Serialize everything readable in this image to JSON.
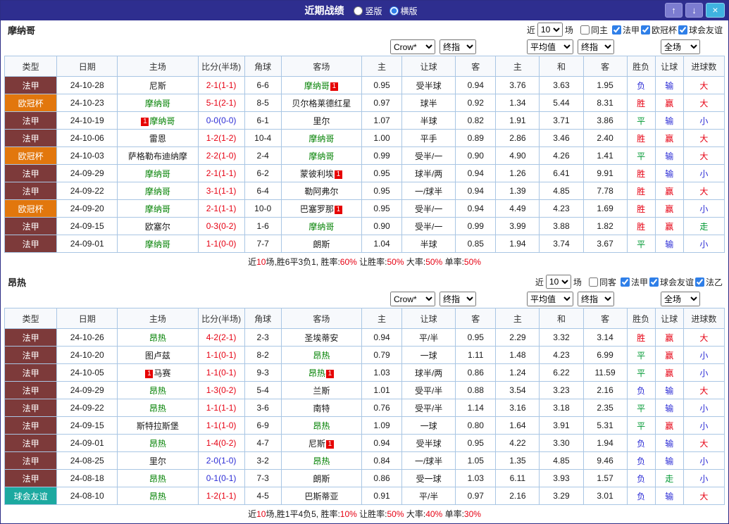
{
  "palette": {
    "red": "#e60012",
    "blue": "#2b2bd5",
    "green": "#009933",
    "black": "#1a1a1a",
    "team_green": "#008000",
    "type_ligue1": "#7d3a3a",
    "type_ucl": "#e2770d",
    "type_friendly": "#1ca9a0",
    "card_red": "#e60000",
    "titlebar_bg": "#2e2e8f",
    "border_blue": "#a9c6e4"
  },
  "titlebar": {
    "title": "近期战绩",
    "radios": [
      {
        "label": "竖版",
        "checked": false
      },
      {
        "label": "横版",
        "checked": true
      }
    ],
    "up_icon": "↑",
    "down_icon": "↓",
    "close_icon": "×"
  },
  "table": {
    "columns": [
      "类型",
      "日期",
      "主场",
      "比分(半场)",
      "角球",
      "客场",
      "主",
      "让球",
      "客",
      "主",
      "和",
      "客",
      "胜负",
      "让球",
      "进球数"
    ],
    "dropdowns": {
      "bookmaker": "Crow*",
      "final_a": "终指",
      "average": "平均值",
      "final_e": "终指",
      "scope": "全场"
    }
  },
  "sections": [
    {
      "team": "摩纳哥",
      "filter": {
        "near": "近",
        "count": "10",
        "games": "场",
        "same": "同主",
        "leagues": [
          "法甲",
          "欧冠杯",
          "球会友谊"
        ]
      },
      "rows": [
        {
          "type": "法甲",
          "tc": "ligue1",
          "date": "24-10-28",
          "home": {
            "n": "尼斯",
            "c": "black"
          },
          "score": {
            "t": "2-1(1-1)",
            "c": "red"
          },
          "corner": "6-6",
          "away": {
            "n": "摩纳哥",
            "c": "green",
            "card": "1",
            "cardpos": "after"
          },
          "odds": [
            "0.95",
            "受半球",
            "0.94",
            "3.76",
            "3.63",
            "1.95"
          ],
          "res": [
            [
              "负",
              "blue"
            ],
            [
              "输",
              "blue"
            ],
            [
              "大",
              "red"
            ]
          ]
        },
        {
          "type": "欧冠杯",
          "tc": "ucl",
          "date": "24-10-23",
          "home": {
            "n": "摩纳哥",
            "c": "green"
          },
          "score": {
            "t": "5-1(2-1)",
            "c": "red"
          },
          "corner": "8-5",
          "away": {
            "n": "贝尔格莱德红星",
            "c": "black"
          },
          "odds": [
            "0.97",
            "球半",
            "0.92",
            "1.34",
            "5.44",
            "8.31"
          ],
          "res": [
            [
              "胜",
              "red"
            ],
            [
              "赢",
              "red"
            ],
            [
              "大",
              "red"
            ]
          ]
        },
        {
          "type": "法甲",
          "tc": "ligue1",
          "date": "24-10-19",
          "home": {
            "n": "摩纳哥",
            "c": "green",
            "card": "1",
            "cardpos": "before"
          },
          "score": {
            "t": "0-0(0-0)",
            "c": "blue"
          },
          "corner": "6-1",
          "away": {
            "n": "里尔",
            "c": "black"
          },
          "odds": [
            "1.07",
            "半球",
            "0.82",
            "1.91",
            "3.71",
            "3.86"
          ],
          "res": [
            [
              "平",
              "green"
            ],
            [
              "输",
              "blue"
            ],
            [
              "小",
              "blue"
            ]
          ]
        },
        {
          "type": "法甲",
          "tc": "ligue1",
          "date": "24-10-06",
          "home": {
            "n": "雷恩",
            "c": "black"
          },
          "score": {
            "t": "1-2(1-2)",
            "c": "red"
          },
          "corner": "10-4",
          "away": {
            "n": "摩纳哥",
            "c": "green"
          },
          "odds": [
            "1.00",
            "平手",
            "0.89",
            "2.86",
            "3.46",
            "2.40"
          ],
          "res": [
            [
              "胜",
              "red"
            ],
            [
              "赢",
              "red"
            ],
            [
              "大",
              "red"
            ]
          ]
        },
        {
          "type": "欧冠杯",
          "tc": "ucl",
          "date": "24-10-03",
          "home": {
            "n": "萨格勒布迪纳摩",
            "c": "black"
          },
          "score": {
            "t": "2-2(1-0)",
            "c": "red"
          },
          "corner": "2-4",
          "away": {
            "n": "摩纳哥",
            "c": "green"
          },
          "odds": [
            "0.99",
            "受半/一",
            "0.90",
            "4.90",
            "4.26",
            "1.41"
          ],
          "res": [
            [
              "平",
              "green"
            ],
            [
              "输",
              "blue"
            ],
            [
              "大",
              "red"
            ]
          ]
        },
        {
          "type": "法甲",
          "tc": "ligue1",
          "date": "24-09-29",
          "home": {
            "n": "摩纳哥",
            "c": "green"
          },
          "score": {
            "t": "2-1(1-1)",
            "c": "red"
          },
          "corner": "6-2",
          "away": {
            "n": "蒙彼利埃",
            "c": "black",
            "card": "1",
            "cardpos": "after"
          },
          "odds": [
            "0.95",
            "球半/两",
            "0.94",
            "1.26",
            "6.41",
            "9.91"
          ],
          "res": [
            [
              "胜",
              "red"
            ],
            [
              "输",
              "blue"
            ],
            [
              "小",
              "blue"
            ]
          ]
        },
        {
          "type": "法甲",
          "tc": "ligue1",
          "date": "24-09-22",
          "home": {
            "n": "摩纳哥",
            "c": "green"
          },
          "score": {
            "t": "3-1(1-1)",
            "c": "red"
          },
          "corner": "6-4",
          "away": {
            "n": "勒阿弗尔",
            "c": "black"
          },
          "odds": [
            "0.95",
            "一/球半",
            "0.94",
            "1.39",
            "4.85",
            "7.78"
          ],
          "res": [
            [
              "胜",
              "red"
            ],
            [
              "赢",
              "red"
            ],
            [
              "大",
              "red"
            ]
          ]
        },
        {
          "type": "欧冠杯",
          "tc": "ucl",
          "date": "24-09-20",
          "home": {
            "n": "摩纳哥",
            "c": "green"
          },
          "score": {
            "t": "2-1(1-1)",
            "c": "red"
          },
          "corner": "10-0",
          "away": {
            "n": "巴塞罗那",
            "c": "black",
            "card": "1",
            "cardpos": "after"
          },
          "odds": [
            "0.95",
            "受半/一",
            "0.94",
            "4.49",
            "4.23",
            "1.69"
          ],
          "res": [
            [
              "胜",
              "red"
            ],
            [
              "赢",
              "red"
            ],
            [
              "小",
              "blue"
            ]
          ]
        },
        {
          "type": "法甲",
          "tc": "ligue1",
          "date": "24-09-15",
          "home": {
            "n": "欧塞尔",
            "c": "black"
          },
          "score": {
            "t": "0-3(0-2)",
            "c": "red"
          },
          "corner": "1-6",
          "away": {
            "n": "摩纳哥",
            "c": "green"
          },
          "odds": [
            "0.90",
            "受半/一",
            "0.99",
            "3.99",
            "3.88",
            "1.82"
          ],
          "res": [
            [
              "胜",
              "red"
            ],
            [
              "赢",
              "red"
            ],
            [
              "走",
              "green"
            ]
          ]
        },
        {
          "type": "法甲",
          "tc": "ligue1",
          "date": "24-09-01",
          "home": {
            "n": "摩纳哥",
            "c": "green"
          },
          "score": {
            "t": "1-1(0-0)",
            "c": "red"
          },
          "corner": "7-7",
          "away": {
            "n": "朗斯",
            "c": "black"
          },
          "odds": [
            "1.04",
            "半球",
            "0.85",
            "1.94",
            "3.74",
            "3.67"
          ],
          "res": [
            [
              "平",
              "green"
            ],
            [
              "输",
              "blue"
            ],
            [
              "小",
              "blue"
            ]
          ]
        }
      ],
      "summary": [
        [
          "近",
          "black"
        ],
        [
          "10",
          "red"
        ],
        [
          "场,胜6平3负1, 胜率:",
          "black"
        ],
        [
          "60%",
          "red"
        ],
        [
          " 让胜率:",
          "black"
        ],
        [
          "50%",
          "red"
        ],
        [
          " 大率:",
          "black"
        ],
        [
          "50%",
          "red"
        ],
        [
          " 单率:",
          "black"
        ],
        [
          "50%",
          "red"
        ]
      ]
    },
    {
      "team": "昂热",
      "filter": {
        "near": "近",
        "count": "10",
        "games": "场",
        "same": "同客",
        "leagues": [
          "法甲",
          "球会友谊",
          "法乙"
        ]
      },
      "rows": [
        {
          "type": "法甲",
          "tc": "ligue1",
          "date": "24-10-26",
          "home": {
            "n": "昂热",
            "c": "green"
          },
          "score": {
            "t": "4-2(2-1)",
            "c": "red"
          },
          "corner": "2-3",
          "away": {
            "n": "圣埃蒂安",
            "c": "black"
          },
          "odds": [
            "0.94",
            "平/半",
            "0.95",
            "2.29",
            "3.32",
            "3.14"
          ],
          "res": [
            [
              "胜",
              "red"
            ],
            [
              "赢",
              "red"
            ],
            [
              "大",
              "red"
            ]
          ]
        },
        {
          "type": "法甲",
          "tc": "ligue1",
          "date": "24-10-20",
          "home": {
            "n": "图卢兹",
            "c": "black"
          },
          "score": {
            "t": "1-1(0-1)",
            "c": "red"
          },
          "corner": "8-2",
          "away": {
            "n": "昂热",
            "c": "green"
          },
          "odds": [
            "0.79",
            "一球",
            "1.11",
            "1.48",
            "4.23",
            "6.99"
          ],
          "res": [
            [
              "平",
              "green"
            ],
            [
              "赢",
              "red"
            ],
            [
              "小",
              "blue"
            ]
          ]
        },
        {
          "type": "法甲",
          "tc": "ligue1",
          "date": "24-10-05",
          "home": {
            "n": "马赛",
            "c": "black",
            "card": "1",
            "cardpos": "before"
          },
          "score": {
            "t": "1-1(0-1)",
            "c": "red"
          },
          "corner": "9-3",
          "away": {
            "n": "昂热",
            "c": "green",
            "card": "1",
            "cardpos": "after"
          },
          "odds": [
            "1.03",
            "球半/两",
            "0.86",
            "1.24",
            "6.22",
            "11.59"
          ],
          "res": [
            [
              "平",
              "green"
            ],
            [
              "赢",
              "red"
            ],
            [
              "小",
              "blue"
            ]
          ]
        },
        {
          "type": "法甲",
          "tc": "ligue1",
          "date": "24-09-29",
          "home": {
            "n": "昂热",
            "c": "green"
          },
          "score": {
            "t": "1-3(0-2)",
            "c": "red"
          },
          "corner": "5-4",
          "away": {
            "n": "兰斯",
            "c": "black"
          },
          "odds": [
            "1.01",
            "受平/半",
            "0.88",
            "3.54",
            "3.23",
            "2.16"
          ],
          "res": [
            [
              "负",
              "blue"
            ],
            [
              "输",
              "blue"
            ],
            [
              "大",
              "red"
            ]
          ]
        },
        {
          "type": "法甲",
          "tc": "ligue1",
          "date": "24-09-22",
          "home": {
            "n": "昂热",
            "c": "green"
          },
          "score": {
            "t": "1-1(1-1)",
            "c": "red"
          },
          "corner": "3-6",
          "away": {
            "n": "南特",
            "c": "black"
          },
          "odds": [
            "0.76",
            "受平/半",
            "1.14",
            "3.16",
            "3.18",
            "2.35"
          ],
          "res": [
            [
              "平",
              "green"
            ],
            [
              "输",
              "blue"
            ],
            [
              "小",
              "blue"
            ]
          ]
        },
        {
          "type": "法甲",
          "tc": "ligue1",
          "date": "24-09-15",
          "home": {
            "n": "斯特拉斯堡",
            "c": "black"
          },
          "score": {
            "t": "1-1(1-0)",
            "c": "red"
          },
          "corner": "6-9",
          "away": {
            "n": "昂热",
            "c": "green"
          },
          "odds": [
            "1.09",
            "一球",
            "0.80",
            "1.64",
            "3.91",
            "5.31"
          ],
          "res": [
            [
              "平",
              "green"
            ],
            [
              "赢",
              "red"
            ],
            [
              "小",
              "blue"
            ]
          ]
        },
        {
          "type": "法甲",
          "tc": "ligue1",
          "date": "24-09-01",
          "home": {
            "n": "昂热",
            "c": "green"
          },
          "score": {
            "t": "1-4(0-2)",
            "c": "red"
          },
          "corner": "4-7",
          "away": {
            "n": "尼斯",
            "c": "black",
            "card": "1",
            "cardpos": "after"
          },
          "odds": [
            "0.94",
            "受半球",
            "0.95",
            "4.22",
            "3.30",
            "1.94"
          ],
          "res": [
            [
              "负",
              "blue"
            ],
            [
              "输",
              "blue"
            ],
            [
              "大",
              "red"
            ]
          ]
        },
        {
          "type": "法甲",
          "tc": "ligue1",
          "date": "24-08-25",
          "home": {
            "n": "里尔",
            "c": "black"
          },
          "score": {
            "t": "2-0(1-0)",
            "c": "blue"
          },
          "corner": "3-2",
          "away": {
            "n": "昂热",
            "c": "green"
          },
          "odds": [
            "0.84",
            "一/球半",
            "1.05",
            "1.35",
            "4.85",
            "9.46"
          ],
          "res": [
            [
              "负",
              "blue"
            ],
            [
              "输",
              "blue"
            ],
            [
              "小",
              "blue"
            ]
          ]
        },
        {
          "type": "法甲",
          "tc": "ligue1",
          "date": "24-08-18",
          "home": {
            "n": "昂热",
            "c": "green"
          },
          "score": {
            "t": "0-1(0-1)",
            "c": "blue"
          },
          "corner": "7-3",
          "away": {
            "n": "朗斯",
            "c": "black"
          },
          "odds": [
            "0.86",
            "受一球",
            "1.03",
            "6.11",
            "3.93",
            "1.57"
          ],
          "res": [
            [
              "负",
              "blue"
            ],
            [
              "走",
              "green"
            ],
            [
              "小",
              "blue"
            ]
          ]
        },
        {
          "type": "球会友谊",
          "tc": "friendly",
          "date": "24-08-10",
          "home": {
            "n": "昂热",
            "c": "green"
          },
          "score": {
            "t": "1-2(1-1)",
            "c": "red"
          },
          "corner": "4-5",
          "away": {
            "n": "巴斯蒂亚",
            "c": "black"
          },
          "odds": [
            "0.91",
            "平/半",
            "0.97",
            "2.16",
            "3.29",
            "3.01"
          ],
          "res": [
            [
              "负",
              "blue"
            ],
            [
              "输",
              "blue"
            ],
            [
              "大",
              "red"
            ]
          ]
        }
      ],
      "summary": [
        [
          "近",
          "black"
        ],
        [
          "10",
          "red"
        ],
        [
          "场,胜1平4负5, 胜率:",
          "black"
        ],
        [
          "10%",
          "red"
        ],
        [
          " 让胜率:",
          "black"
        ],
        [
          "50%",
          "red"
        ],
        [
          " 大率:",
          "black"
        ],
        [
          "40%",
          "red"
        ],
        [
          " 单率:",
          "black"
        ],
        [
          "30%",
          "red"
        ]
      ]
    }
  ]
}
